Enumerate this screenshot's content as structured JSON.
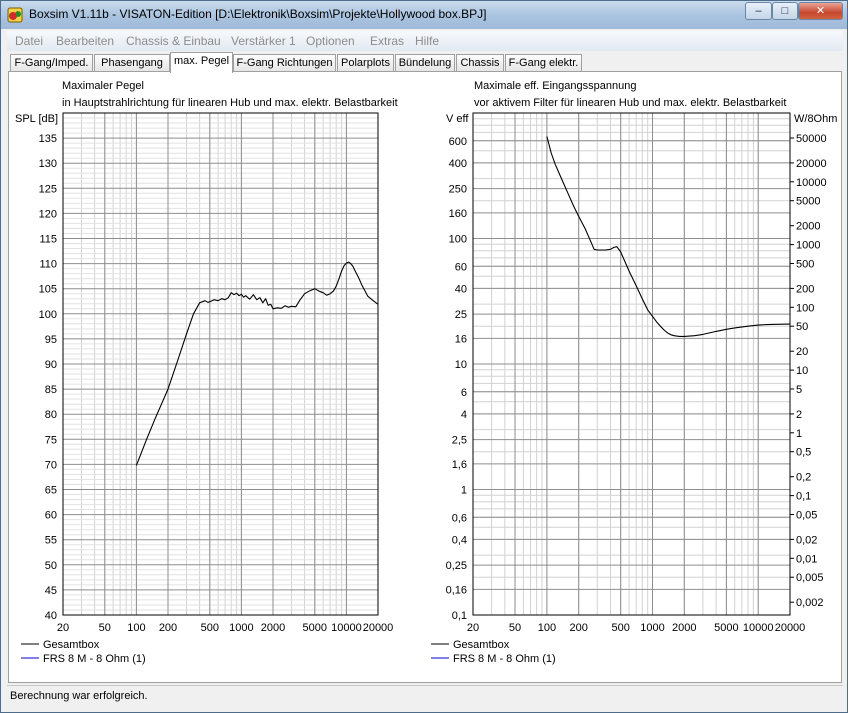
{
  "window": {
    "title": "Boxsim V1.11b - VISATON-Edition [D:\\Elektronik\\Boxsim\\Projekte\\Hollywood box.BPJ]",
    "minimize_glyph": "–",
    "maximize_glyph": "□",
    "close_glyph": "✕",
    "icon": "boxsim-app-icon"
  },
  "menu": [
    "Datei",
    "Bearbeiten",
    "Chassis & Einbau",
    "Verstärker 1",
    "Optionen",
    "Extras",
    "Hilfe"
  ],
  "tabs": [
    {
      "label": "F-Gang/Imped.",
      "active": false
    },
    {
      "label": "Phasengang",
      "active": false
    },
    {
      "label": "max. Pegel",
      "active": true
    },
    {
      "label": "F-Gang Richtungen",
      "active": false
    },
    {
      "label": "Polarplots",
      "active": false
    },
    {
      "label": "Bündelung",
      "active": false
    },
    {
      "label": "Chassis",
      "active": false
    },
    {
      "label": "F-Gang elektr.",
      "active": false
    }
  ],
  "status": "Berechnung war erfolgreich.",
  "chart_data": [
    {
      "type": "line",
      "title": "Maximaler Pegel",
      "subtitle": "in Hauptstrahlrichtung für linearen Hub und max. elektr. Belastbarkeit",
      "ylabel": "SPL [dB]",
      "xscale": "log",
      "xlim": [
        20,
        20000
      ],
      "ylim": [
        40,
        140
      ],
      "grid": true,
      "xticks": [
        20,
        50,
        100,
        200,
        500,
        1000,
        2000,
        5000,
        10000,
        20000
      ],
      "xtick_labels": [
        "20",
        "50",
        "100",
        "200",
        "500",
        "1000",
        "2000",
        "5000",
        "10000",
        "20000"
      ],
      "yticks": [
        40,
        45,
        50,
        55,
        60,
        65,
        70,
        75,
        80,
        85,
        90,
        95,
        100,
        105,
        110,
        115,
        120,
        125,
        130,
        135
      ],
      "ytick_labels": [
        "40",
        "45",
        "50",
        "55",
        "60",
        "65",
        "70",
        "75",
        "80",
        "85",
        "90",
        "95",
        "100",
        "105",
        "110",
        "115",
        "120",
        "125",
        "130",
        "135"
      ],
      "legend": [
        "Gesamtbox",
        "FRS 8 M - 8 Ohm (1)"
      ],
      "legend_colors": [
        "#000000",
        "#0000cc"
      ],
      "legend_position": "bottom-left",
      "series": [
        {
          "name": "Gesamtbox",
          "color": "#000000",
          "x": [
            100,
            125,
            150,
            200,
            250,
            300,
            350,
            400,
            450,
            480,
            500,
            550,
            600,
            650,
            700,
            750,
            800,
            850,
            900,
            950,
            1000,
            1050,
            1100,
            1200,
            1300,
            1400,
            1500,
            1600,
            1700,
            1800,
            1900,
            2000,
            2200,
            2400,
            2600,
            2800,
            3000,
            3300,
            3600,
            4000,
            4500,
            5000,
            5500,
            6000,
            6500,
            7000,
            7500,
            8000,
            8500,
            9000,
            9500,
            10000,
            10500,
            11000,
            11500,
            12000,
            13000,
            14000,
            15000,
            16000,
            18000,
            20000
          ],
          "y": [
            69.8,
            75,
            79,
            85,
            91,
            96,
            100,
            102.2,
            102.6,
            102.3,
            102.4,
            102.8,
            102.6,
            103,
            102.8,
            103.2,
            104.2,
            103.8,
            104.1,
            103.6,
            103.9,
            103.3,
            103.6,
            102.9,
            103.8,
            102.8,
            103.2,
            102.2,
            103,
            101.7,
            101.9,
            101,
            101.2,
            101.1,
            101.6,
            101.3,
            101.5,
            101.4,
            102.7,
            104,
            104.6,
            105,
            104.5,
            104.2,
            103.7,
            104,
            104.5,
            105.5,
            107,
            108.5,
            109.6,
            110.1,
            110.3,
            110,
            109.5,
            108.7,
            107.3,
            105.8,
            104.6,
            103.5,
            102.6,
            101.9
          ]
        }
      ]
    },
    {
      "type": "line",
      "title": "Maximale eff. Eingangsspannung",
      "subtitle": "vor aktivem Filter für linearen Hub und max. elektr. Belastbarkeit",
      "ylabel": "V eff",
      "ylabel_right": "W/8Ohm",
      "xscale": "log",
      "yscale": "log",
      "xlim": [
        20,
        20000
      ],
      "ylim": [
        0.1,
        1000
      ],
      "grid": true,
      "xticks": [
        20,
        50,
        100,
        200,
        500,
        1000,
        2000,
        5000,
        10000,
        20000
      ],
      "xtick_labels": [
        "20",
        "50",
        "100",
        "200",
        "500",
        "1000",
        "2000",
        "5000",
        "10000",
        "20000"
      ],
      "yticks": [
        0.1,
        0.16,
        0.25,
        0.4,
        0.6,
        1,
        1.6,
        2.5,
        4,
        6,
        10,
        16,
        25,
        40,
        60,
        100,
        160,
        250,
        400,
        600
      ],
      "ytick_labels": [
        "0,1",
        "0,16",
        "0,25",
        "0,4",
        "0,6",
        "1",
        "1,6",
        "2,5",
        "4",
        "6",
        "10",
        "16",
        "25",
        "40",
        "60",
        "100",
        "160",
        "250",
        "400",
        "600"
      ],
      "right_ticks": [
        0.002,
        0.005,
        0.01,
        0.02,
        0.05,
        0.1,
        0.2,
        0.5,
        1,
        2,
        5,
        10,
        20,
        50,
        100,
        200,
        500,
        1000,
        2000,
        5000,
        10000,
        20000,
        50000
      ],
      "right_tick_labels": [
        "0,002",
        "0,005",
        "0,01",
        "0,02",
        "0,05",
        "0,1",
        "0,2",
        "0,5",
        "1",
        "2",
        "5",
        "10",
        "20",
        "50",
        "100",
        "200",
        "500",
        "1000",
        "2000",
        "5000",
        "10000",
        "20000",
        "50000"
      ],
      "legend": [
        "Gesamtbox",
        "FRS 8 M - 8 Ohm (1)"
      ],
      "legend_colors": [
        "#000000",
        "#0000cc"
      ],
      "legend_position": "bottom-left",
      "series": [
        {
          "name": "Gesamtbox",
          "color": "#000000",
          "x": [
            100,
            110,
            120,
            140,
            160,
            180,
            200,
            230,
            260,
            280,
            300,
            330,
            360,
            400,
            430,
            460,
            500,
            550,
            600,
            700,
            800,
            900,
            1000,
            1100,
            1200,
            1300,
            1400,
            1500,
            1600,
            1800,
            2000,
            2500,
            3000,
            4000,
            5000,
            6000,
            8000,
            10000,
            12000,
            15000,
            20000
          ],
          "y": [
            650,
            480,
            390,
            290,
            225,
            180,
            150,
            120,
            95,
            82,
            81,
            81,
            81,
            82,
            85,
            86,
            78,
            65,
            55,
            42,
            33,
            27,
            24,
            21.5,
            19.8,
            18.5,
            17.6,
            17.1,
            16.8,
            16.6,
            16.6,
            16.8,
            17.2,
            18.2,
            18.9,
            19.4,
            20,
            20.4,
            20.6,
            20.7,
            20.8
          ]
        }
      ]
    }
  ]
}
